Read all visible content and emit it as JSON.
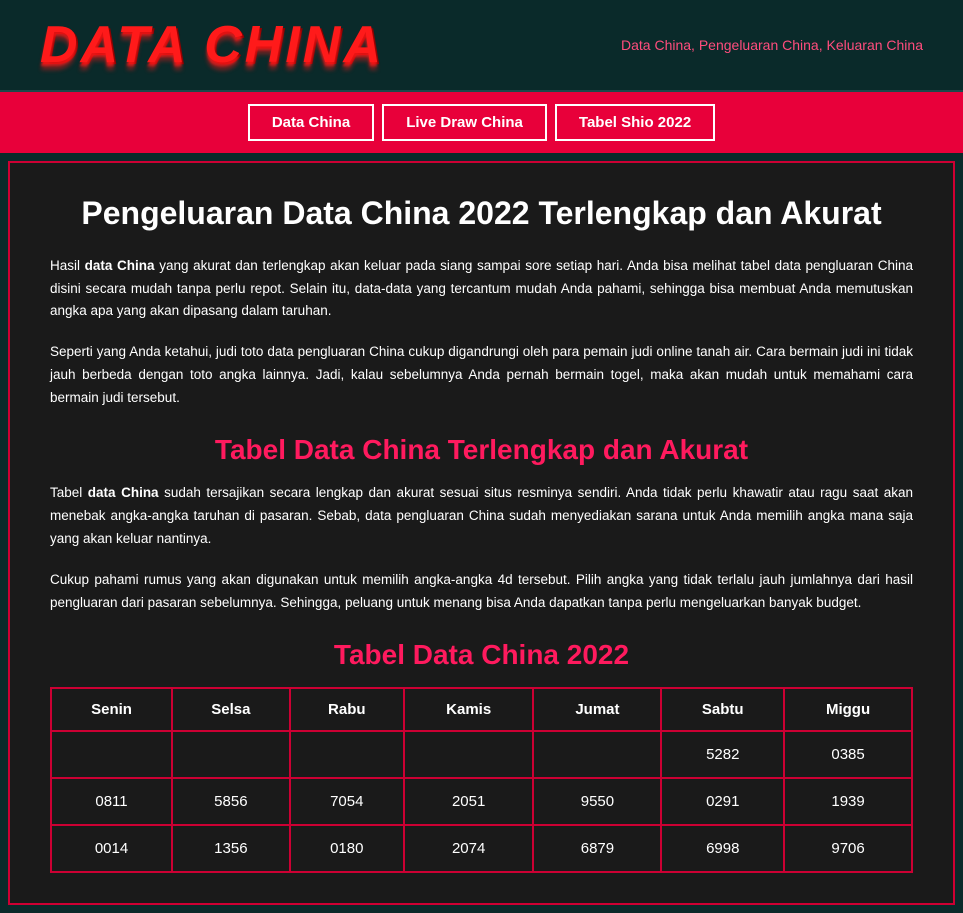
{
  "header": {
    "logo_text": "DATA CHINA",
    "tagline": "Data China, Pengeluaran China, Keluaran China"
  },
  "nav": {
    "items": [
      {
        "label": "Data China",
        "id": "data-china"
      },
      {
        "label": "Live Draw China",
        "id": "live-draw-china"
      },
      {
        "label": "Tabel Shio 2022",
        "id": "tabel-shio"
      }
    ]
  },
  "main": {
    "page_title": "Pengeluaran Data China 2022 Terlengkap dan Akurat",
    "intro_paragraph_1": "Hasil data China yang akurat dan terlengkap akan keluar pada siang sampai sore setiap hari. Anda bisa melihat tabel data pengluaran China disini secara mudah tanpa perlu repot. Selain itu, data-data yang tercantum mudah Anda pahami, sehingga bisa membuat Anda memutuskan angka apa yang akan dipasang dalam taruhan.",
    "intro_paragraph_2": "Seperti yang Anda ketahui, judi toto data pengluaran China cukup digandrungi oleh para pemain judi online tanah air. Cara bermain judi ini tidak jauh berbeda dengan toto angka lainnya. Jadi, kalau sebelumnya Anda pernah bermain togel, maka akan mudah untuk memahami cara bermain judi tersebut.",
    "section_title": "Tabel Data China Terlengkap dan Akurat",
    "section_paragraph_1": "Tabel data China sudah tersajikan secara lengkap dan akurat sesuai situs resminya sendiri. Anda tidak perlu khawatir atau ragu saat akan menebak angka-angka taruhan di pasaran. Sebab, data pengluaran China sudah menyediakan sarana untuk Anda memilih angka mana saja yang akan keluar nantinya.",
    "section_paragraph_2": "Cukup pahami rumus yang akan digunakan untuk memilih angka-angka 4d tersebut. Pilih angka yang tidak terlalu jauh jumlahnya dari hasil pengluaran dari pasaran sebelumnya. Sehingga, peluang untuk menang bisa Anda dapatkan tanpa perlu mengeluarkan banyak budget.",
    "table_title": "Tabel Data China 2022",
    "table": {
      "headers": [
        "Senin",
        "Selsa",
        "Rabu",
        "Kamis",
        "Jumat",
        "Sabtu",
        "Miggu"
      ],
      "rows": [
        [
          "",
          "",
          "",
          "",
          "",
          "5282",
          "0385"
        ],
        [
          "0811",
          "5856",
          "7054",
          "2051",
          "9550",
          "0291",
          "1939"
        ],
        [
          "0014",
          "1356",
          "0180",
          "2074",
          "6879",
          "6998",
          "9706"
        ]
      ]
    }
  }
}
